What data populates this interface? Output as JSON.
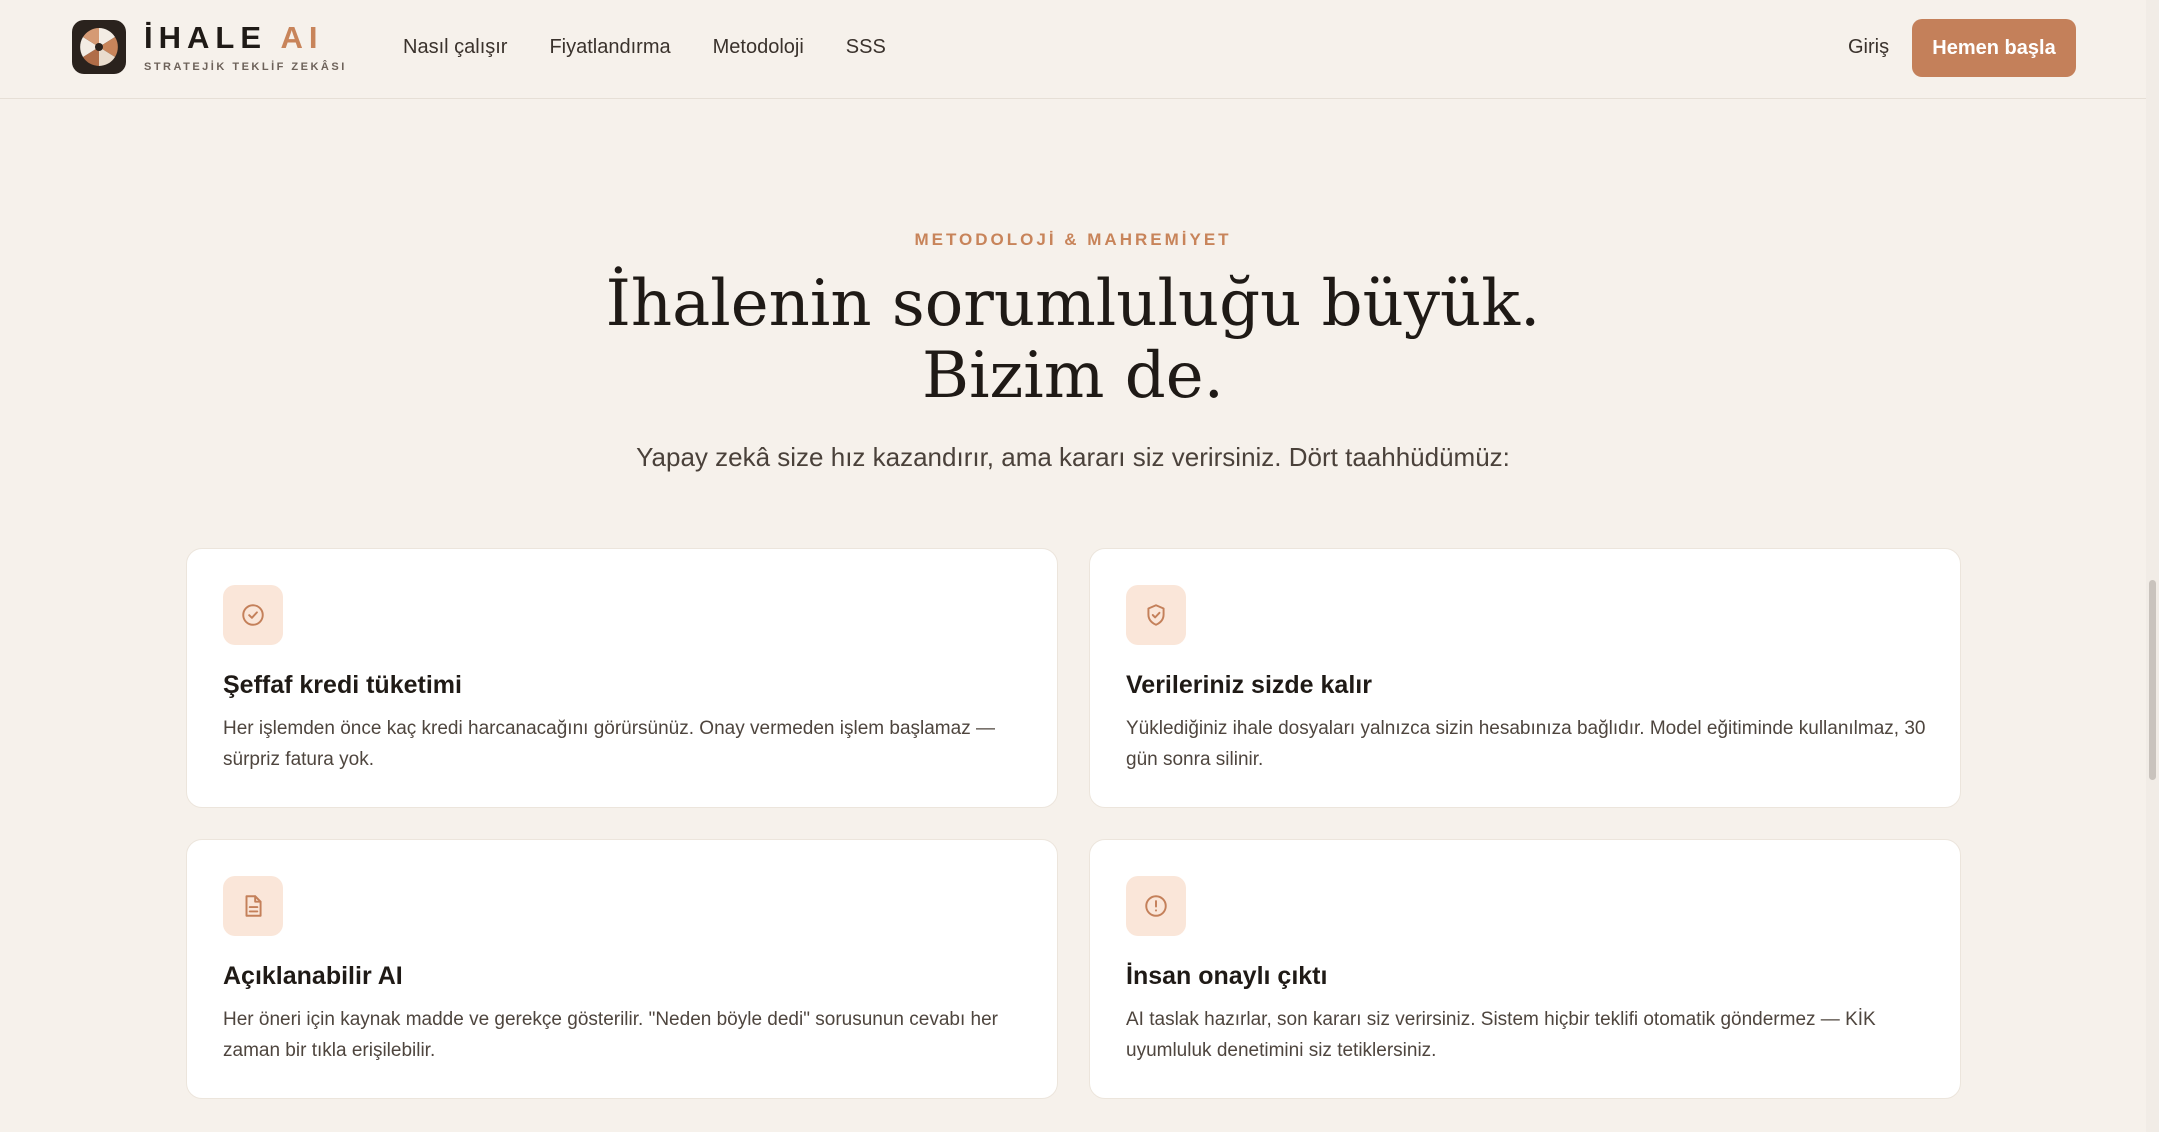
{
  "brand": {
    "title_main": "İHALE",
    "title_accent": "AI",
    "subtitle": "STRATEJİK TEKLİF ZEKÂSI",
    "logo_icon": "aperture-logo-icon"
  },
  "nav": {
    "items": [
      {
        "label": "Nasıl çalışır"
      },
      {
        "label": "Fiyatlandırma"
      },
      {
        "label": "Metodoloji"
      },
      {
        "label": "SSS"
      }
    ],
    "login_label": "Giriş",
    "cta_label": "Hemen başla"
  },
  "section": {
    "eyebrow": "METODOLOJİ & MAHREMİYET",
    "headline_line1": "İhalenin sorumluluğu büyük.",
    "headline_line2": "Bizim de.",
    "lede": "Yapay zekâ size hız kazandırır, ama kararı siz verirsiniz. Dört taahhüdümüz:"
  },
  "cards": [
    {
      "icon": "check-circle-icon",
      "title": "Şeffaf kredi tüketimi",
      "description": "Her işlemden önce kaç kredi harcanacağını görürsünüz. Onay vermeden işlem başlamaz — sürpriz fatura yok."
    },
    {
      "icon": "shield-check-icon",
      "title": "Verileriniz sizde kalır",
      "description": "Yüklediğiniz ihale dosyaları yalnızca sizin hesabınıza bağlıdır. Model eğitiminde kullanılmaz, 30 gün sonra silinir."
    },
    {
      "icon": "document-icon",
      "title": "Açıklanabilir AI",
      "description": "Her öneri için kaynak madde ve gerekçe gösterilir. \"Neden böyle dedi\" sorusunun cevabı her zaman bir tıkla erişilebilir."
    },
    {
      "icon": "alert-circle-icon",
      "title": "İnsan onaylı çıktı",
      "description": "AI taslak hazırlar, son kararı siz verirsiniz. Sistem hiçbir teklifi otomatik göndermez — KİK uyumluluk denetimini siz tetiklersiniz."
    }
  ],
  "colors": {
    "background": "#f6f1eb",
    "accent": "#c4805a",
    "icon_bg": "#fae6d9",
    "dark": "#1f1a16"
  }
}
